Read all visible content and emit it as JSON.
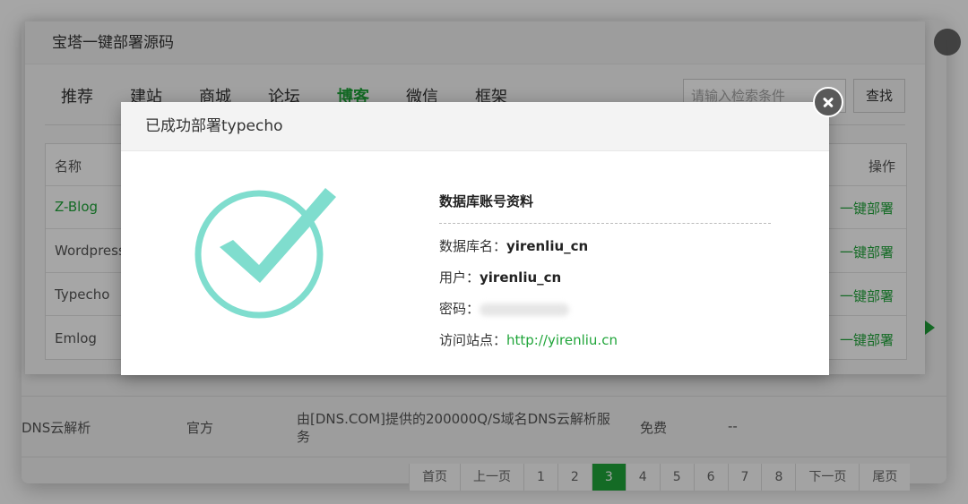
{
  "background": {
    "rows": [
      {
        "name": "DNS云解析",
        "type": "官方",
        "desc": "由[DNS.COM]提供的200000Q/S域名DNS云解析服务",
        "price": "免费",
        "action": "--"
      }
    ],
    "pager": [
      "首页",
      "上一页",
      "1",
      "2",
      "3",
      "4",
      "5",
      "6",
      "7",
      "8",
      "下一页",
      "尾页"
    ],
    "active_page": "3"
  },
  "deploy_dialog": {
    "title": "宝塔一键部署源码",
    "tabs": [
      "推荐",
      "建站",
      "商城",
      "论坛",
      "博客",
      "微信",
      "框架"
    ],
    "active_tab": "博客",
    "search_placeholder": "请输入检索条件",
    "search_button": "查找",
    "table": {
      "headers": {
        "name": "名称",
        "action": "操作"
      },
      "rows": [
        {
          "name": "Z-Blog",
          "action": "一键部署"
        },
        {
          "name": "Wordpress",
          "action": "一键部署"
        },
        {
          "name": "Typecho",
          "action": "一键部署"
        },
        {
          "name": "Emlog",
          "action": "一键部署"
        }
      ]
    }
  },
  "success_dialog": {
    "title": "已成功部署typecho",
    "info_title": "数据库账号资料",
    "db_name_label": "数据库名：",
    "db_name": "yirenliu_cn",
    "user_label": "用户：",
    "user": "yirenliu_cn",
    "password_label": "密码：",
    "site_label": "访问站点：",
    "site_url": "http://yirenliu.cn",
    "check_color": "#7fddce",
    "icon": "check-circle-icon"
  },
  "colors": {
    "accent": "#20a53a",
    "close_button": "#595959"
  }
}
